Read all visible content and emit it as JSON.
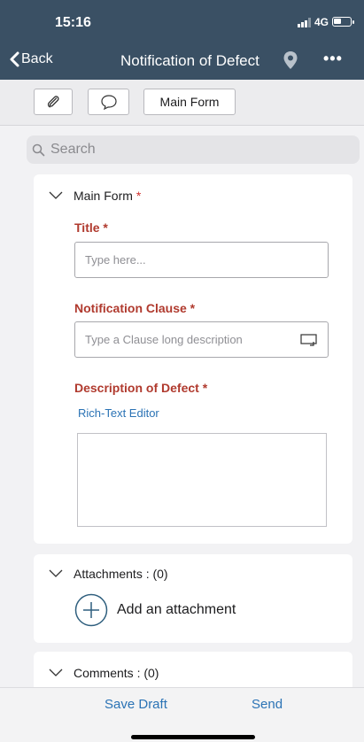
{
  "status": {
    "time": "15:16",
    "network": "4G"
  },
  "nav": {
    "back_label": "Back",
    "title": "Notification of Defect",
    "more_label": "•••"
  },
  "toolbar": {
    "main_form_label": "Main Form"
  },
  "search": {
    "placeholder": "Search"
  },
  "main_form": {
    "section_label": "Main Form",
    "required_mark": "*",
    "title_label": "Title *",
    "title_placeholder": "Type here...",
    "clause_label": "Notification Clause *",
    "clause_placeholder": "Type a Clause long description",
    "description_label": "Description of Defect *",
    "rich_text_label": "Rich-Text Editor"
  },
  "attachments": {
    "section_label": "Attachments : (0)",
    "add_label": "Add an attachment"
  },
  "comments": {
    "section_label": "Comments : (0)"
  },
  "footer": {
    "save_draft_label": "Save Draft",
    "send_label": "Send"
  },
  "colors": {
    "nav_bg": "#3a5064",
    "required_red": "#b03a2e",
    "link_blue": "#2b73b5"
  }
}
